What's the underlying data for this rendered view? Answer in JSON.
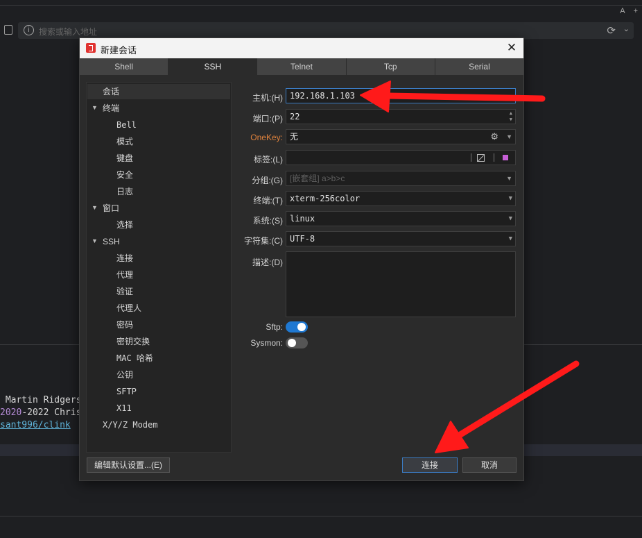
{
  "background": {
    "top_icons": [
      "A",
      "+"
    ],
    "address_placeholder": "搜索或输入地址",
    "terminal_lines": [
      {
        "prefix": "",
        "highlight": "",
        "text": " Martin Ridgers",
        "link": ""
      },
      {
        "prefix": "",
        "highlight": "2020",
        "text": "-2022 Chris",
        "link": ""
      },
      {
        "prefix": "",
        "highlight": "",
        "text": "",
        "link": "sant996/clink"
      }
    ]
  },
  "dialog": {
    "title": "新建会话",
    "close_symbol": "✕",
    "tabs": [
      "Shell",
      "SSH",
      "Telnet",
      "Tcp",
      "Serial"
    ],
    "active_tab": "SSH",
    "tree": [
      {
        "label": "会话",
        "level": 0,
        "caret": "",
        "selected": true
      },
      {
        "label": "终端",
        "level": 0,
        "caret": "▼"
      },
      {
        "label": "Bell",
        "level": 1
      },
      {
        "label": "模式",
        "level": 1
      },
      {
        "label": "键盘",
        "level": 1
      },
      {
        "label": "安全",
        "level": 1
      },
      {
        "label": "日志",
        "level": 1
      },
      {
        "label": "窗口",
        "level": 0,
        "caret": "▼"
      },
      {
        "label": "选择",
        "level": 1
      },
      {
        "label": "SSH",
        "level": 0,
        "caret": "▼"
      },
      {
        "label": "连接",
        "level": 1
      },
      {
        "label": "代理",
        "level": 1
      },
      {
        "label": "验证",
        "level": 1
      },
      {
        "label": "代理人",
        "level": 1
      },
      {
        "label": "密码",
        "level": 1
      },
      {
        "label": "密钥交换",
        "level": 1
      },
      {
        "label": "MAC 哈希",
        "level": 1
      },
      {
        "label": "公钥",
        "level": 1
      },
      {
        "label": "SFTP",
        "level": 1
      },
      {
        "label": "X11",
        "level": 1
      },
      {
        "label": "X/Y/Z Modem",
        "level": 0,
        "caret": ""
      }
    ],
    "form": {
      "host_label": "主机:(H)",
      "host_value": "192.168.1.103",
      "port_label": "端口:(P)",
      "port_value": "22",
      "onekey_label": "OneKey:",
      "onekey_value": "无",
      "tag_label": "标签:(L)",
      "tag_value": "",
      "group_label": "分组:(G)",
      "group_placeholder": "[嵌套组] a>b>c",
      "terminal_label": "终端:(T)",
      "terminal_value": "xterm-256color",
      "system_label": "系统:(S)",
      "system_value": "linux",
      "charset_label": "字符集:(C)",
      "charset_value": "UTF-8",
      "desc_label": "描述:(D)",
      "desc_value": "",
      "sftp_label": "Sftp:",
      "sftp_on": true,
      "sysmon_label": "Sysmon:",
      "sysmon_on": false
    },
    "buttons": {
      "edit_defaults": "编辑默认设置...(E)",
      "connect": "连接",
      "cancel": "取消"
    }
  },
  "colors": {
    "accent": "#1f78d1",
    "annotation_arrow": "#ff1a1a",
    "onekey_label": "#e0823c",
    "tag_swatch": "#c65fd6"
  }
}
